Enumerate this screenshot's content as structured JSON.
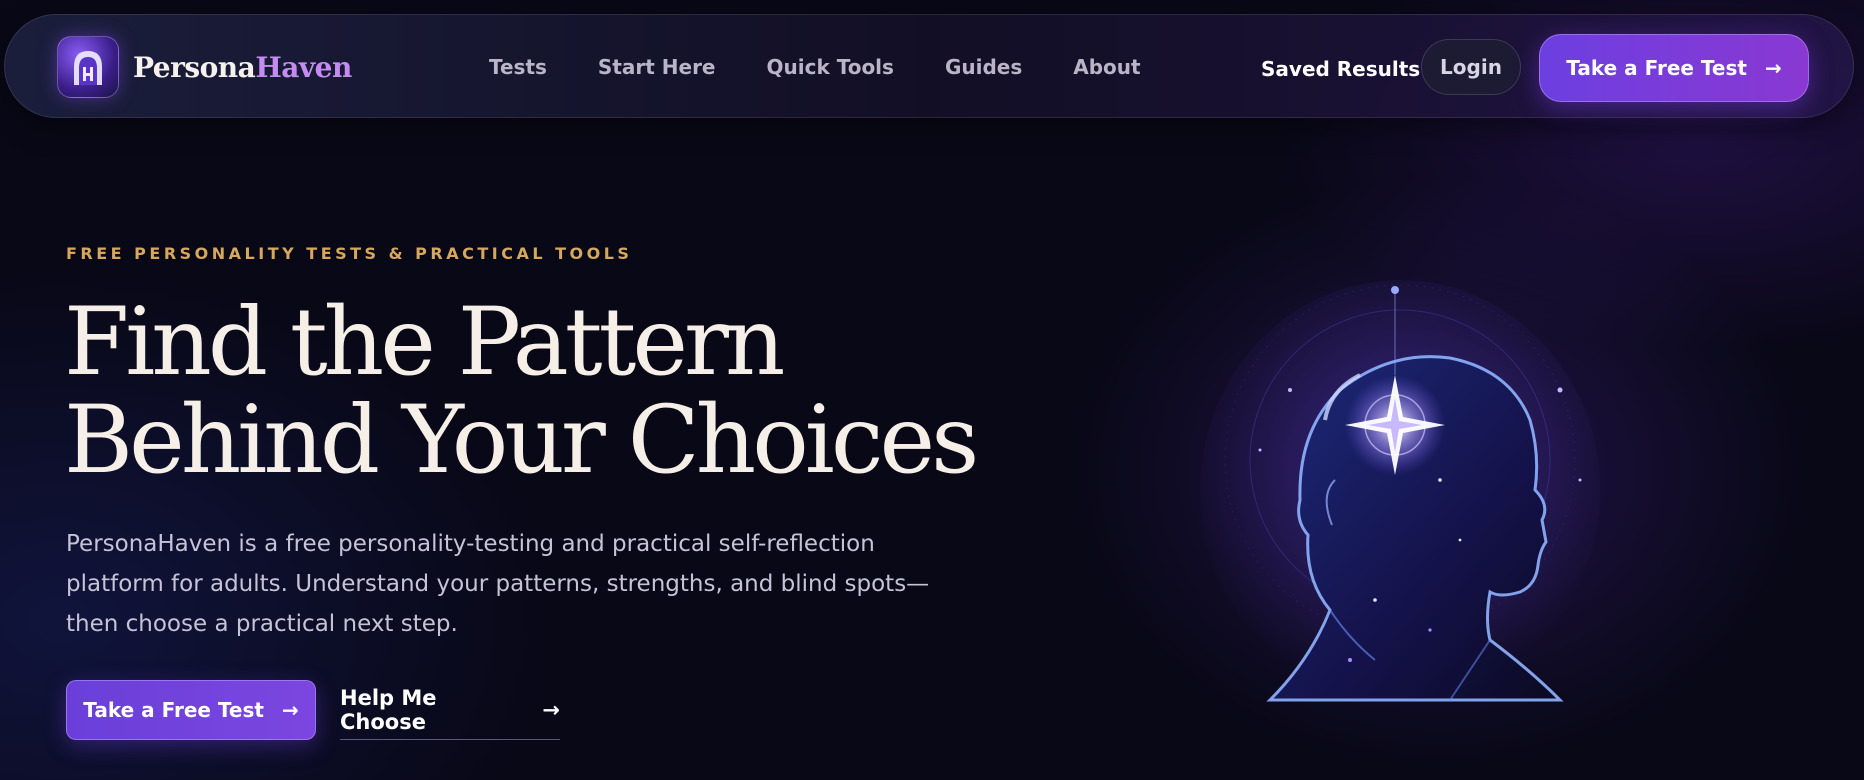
{
  "brand": {
    "name_part1": "Persona",
    "name_part2": "Haven",
    "logo": "arch-h-logo-icon"
  },
  "nav": {
    "items": [
      {
        "label": "Tests"
      },
      {
        "label": "Start Here"
      },
      {
        "label": "Quick Tools"
      },
      {
        "label": "Guides"
      },
      {
        "label": "About"
      }
    ],
    "saved_results": "Saved Results",
    "login": "Login",
    "cta": {
      "label": "Take a Free Test",
      "arrow": "→"
    }
  },
  "hero": {
    "eyebrow": "FREE PERSONALITY TESTS & PRACTICAL TOOLS",
    "headline_line1": "Find the Pattern",
    "headline_line2": "Behind Your Choices",
    "lead": "PersonaHaven is a free personality-testing and practical self-reflection platform for adults. Understand your patterns, strengths, and blind spots—then choose a practical next step.",
    "primary_cta": {
      "label": "Take a Free Test",
      "arrow": "→"
    },
    "secondary_cta": {
      "label": "Help Me Choose",
      "arrow": "→"
    },
    "illustration": "glowing-head-compass-icon"
  },
  "colors": {
    "background": "#090817",
    "accent": "#6c3fe0",
    "eyebrow": "#d6a85d",
    "brand_highlight": "#c48cf0",
    "headline": "#f5efe8"
  }
}
